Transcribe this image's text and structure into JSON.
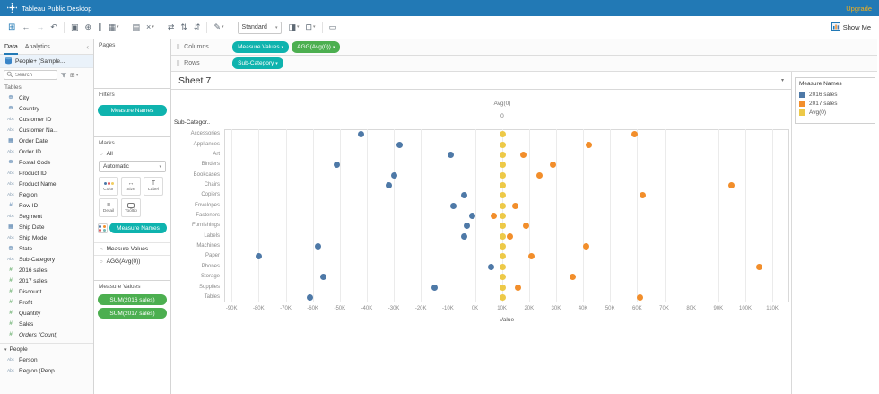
{
  "titlebar": {
    "app_title": "Tableau Public Desktop",
    "upgrade": "Upgrade"
  },
  "toolbar": {
    "standard_label": "Standard",
    "show_me": "Show Me",
    "icons_left": [
      {
        "name": "back-icon",
        "glyph": "←"
      },
      {
        "name": "forward-icon",
        "glyph": "→",
        "muted": true
      },
      {
        "name": "undo-icon",
        "glyph": "↶"
      },
      {
        "sep": true
      },
      {
        "name": "save-icon",
        "glyph": "▣"
      },
      {
        "name": "new-data-source-icon",
        "glyph": "⊕"
      },
      {
        "name": "pause-auto-updates-icon",
        "glyph": "∥"
      },
      {
        "name": "new-worksheet-icon",
        "glyph": "▦",
        "caret": true
      },
      {
        "sep": true
      },
      {
        "name": "duplicate-icon",
        "glyph": "▤"
      },
      {
        "name": "clear-sheet-icon",
        "glyph": "×",
        "caret": true
      },
      {
        "sep": true
      },
      {
        "name": "swap-rows-columns-icon",
        "glyph": "⇄"
      },
      {
        "name": "sort-ascending-icon",
        "glyph": "⇅"
      },
      {
        "name": "sort-descending-icon",
        "glyph": "⇵"
      },
      {
        "sep": true
      },
      {
        "name": "highlight-icon",
        "glyph": "✎",
        "caret": true
      },
      {
        "sep": true
      }
    ],
    "icons_right": [
      {
        "name": "show-mark-labels-icon",
        "glyph": "◨",
        "caret": true
      },
      {
        "name": "fit-axes-icon",
        "glyph": "⊡",
        "caret": true
      },
      {
        "sep": true
      },
      {
        "name": "presentation-mode-icon",
        "glyph": "▭"
      }
    ]
  },
  "sidebar": {
    "tabs": {
      "data": "Data",
      "analytics": "Analytics"
    },
    "datasource": "People+ (Sample...",
    "search_placeholder": "Search",
    "tables_label": "Tables",
    "fields": [
      {
        "icon": "geo",
        "label": "City"
      },
      {
        "icon": "geo",
        "label": "Country"
      },
      {
        "icon": "string",
        "label": "Customer ID"
      },
      {
        "icon": "string",
        "label": "Customer Na..."
      },
      {
        "icon": "date",
        "label": "Order Date"
      },
      {
        "icon": "string",
        "label": "Order ID"
      },
      {
        "icon": "geo",
        "label": "Postal Code"
      },
      {
        "icon": "string",
        "label": "Product ID"
      },
      {
        "icon": "string",
        "label": "Product Name"
      },
      {
        "icon": "string",
        "label": "Region"
      },
      {
        "icon": "num",
        "label": "Row ID"
      },
      {
        "icon": "string",
        "label": "Segment"
      },
      {
        "icon": "date",
        "label": "Ship Date"
      },
      {
        "icon": "string",
        "label": "Ship Mode"
      },
      {
        "icon": "geo",
        "label": "State"
      },
      {
        "icon": "string",
        "label": "Sub-Category"
      },
      {
        "icon": "meas",
        "label": "2016 sales"
      },
      {
        "icon": "meas",
        "label": "2017 sales"
      },
      {
        "icon": "meas",
        "label": "Discount"
      },
      {
        "icon": "meas",
        "label": "Profit"
      },
      {
        "icon": "meas",
        "label": "Quantity"
      },
      {
        "icon": "meas",
        "label": "Sales"
      },
      {
        "icon": "meas",
        "label": "Orders (Count)",
        "italic": true
      }
    ],
    "people_label": "People",
    "people_fields": [
      {
        "icon": "string",
        "label": "Person"
      },
      {
        "icon": "string",
        "label": "Region (Peop..."
      }
    ]
  },
  "pages": {
    "label": "Pages"
  },
  "filters": {
    "label": "Filters",
    "pill": "Measure Names"
  },
  "marks": {
    "label": "Marks",
    "all_label": "All",
    "mark_type": "Automatic",
    "buttons": [
      {
        "label": "Color",
        "icon": "color"
      },
      {
        "label": "Size",
        "icon": "size"
      },
      {
        "label": "Label",
        "icon": "label"
      },
      {
        "label": "Detail",
        "icon": "detail"
      },
      {
        "label": "Tooltip",
        "icon": "tooltip"
      }
    ],
    "pill": "Measure Names",
    "sections": [
      "Measure Values",
      "AGG(Avg(0))"
    ]
  },
  "measure_values_card": {
    "label": "Measure Values",
    "pills": [
      "SUM(2016 sales)",
      "SUM(2017 sales)"
    ]
  },
  "shelves": {
    "columns_label": "Columns",
    "columns_pills": [
      {
        "label": "Measure Values",
        "type": "teal"
      },
      {
        "label": "AGG(Avg(0))",
        "type": "green"
      }
    ],
    "rows_label": "Rows",
    "rows_pills": [
      {
        "label": "Sub-Category",
        "type": "teal"
      }
    ]
  },
  "sheet": {
    "title": "Sheet 7"
  },
  "legend": {
    "title": "Measure Names",
    "items": [
      {
        "label": "2016 sales",
        "color": "#4e79a7"
      },
      {
        "label": "2017 sales",
        "color": "#f28e2b"
      },
      {
        "label": "Avg(0)",
        "color": "#edc948"
      }
    ]
  },
  "chart_data": {
    "type": "scatter",
    "title": "Sheet 7",
    "row_header": "Sub-Categor..",
    "top_axis": {
      "label": "Avg(0)",
      "tick": "0"
    },
    "xlabel": "Value",
    "xlim": [
      -90000,
      110000
    ],
    "tick_step": 10000,
    "x_ticks": [
      "-90K",
      "-80K",
      "-70K",
      "-60K",
      "-50K",
      "-40K",
      "-30K",
      "-20K",
      "-10K",
      "0K",
      "10K",
      "20K",
      "30K",
      "40K",
      "50K",
      "60K",
      "70K",
      "80K",
      "90K",
      "100K",
      "110K"
    ],
    "categories": [
      "Accessories",
      "Appliances",
      "Art",
      "Binders",
      "Bookcases",
      "Chairs",
      "Copiers",
      "Envelopes",
      "Fasteners",
      "Furnishings",
      "Labels",
      "Machines",
      "Paper",
      "Phones",
      "Storage",
      "Supplies",
      "Tables"
    ],
    "series": [
      {
        "name": "2016 sales",
        "color": "#4e79a7",
        "axis": "bottom",
        "values": [
          -42000,
          -28000,
          -9000,
          -51000,
          -30000,
          -32000,
          -4000,
          -8000,
          -1000,
          -3000,
          -4000,
          -58000,
          -80000,
          6000,
          -56000,
          -15000,
          -61000
        ]
      },
      {
        "name": "2017 sales",
        "color": "#f28e2b",
        "axis": "bottom",
        "values": [
          59000,
          42000,
          18000,
          29000,
          24000,
          95000,
          62000,
          15000,
          7000,
          19000,
          13000,
          41000,
          21000,
          105000,
          36000,
          16000,
          61000
        ]
      },
      {
        "name": "Avg(0)",
        "color": "#edc948",
        "axis": "top",
        "values": [
          0,
          0,
          0,
          0,
          0,
          0,
          0,
          0,
          0,
          0,
          0,
          0,
          0,
          0,
          0,
          0,
          0
        ]
      }
    ],
    "grid": true,
    "legend_position": "right"
  }
}
